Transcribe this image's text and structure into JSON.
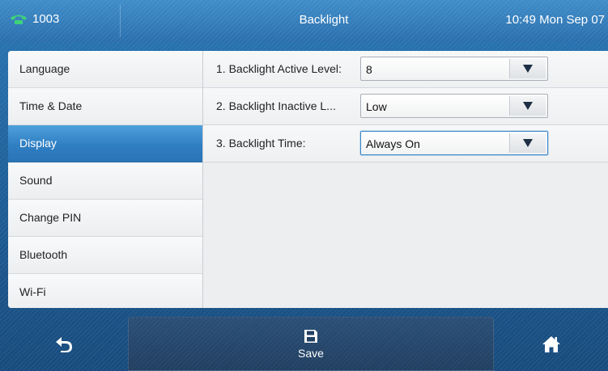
{
  "status_bar": {
    "account": "1003",
    "title": "Backlight",
    "clock": "10:49 Mon Sep 07"
  },
  "sidebar": {
    "items": [
      {
        "label": "Language",
        "active": false
      },
      {
        "label": "Time & Date",
        "active": false
      },
      {
        "label": "Display",
        "active": true
      },
      {
        "label": "Sound",
        "active": false
      },
      {
        "label": "Change PIN",
        "active": false
      },
      {
        "label": "Bluetooth",
        "active": false
      },
      {
        "label": "Wi-Fi",
        "active": false
      }
    ]
  },
  "settings": [
    {
      "label": "1. Backlight Active Level:",
      "value": "8"
    },
    {
      "label": "2. Backlight Inactive L...",
      "value": "Low"
    },
    {
      "label": "3. Backlight Time:",
      "value": "Always On",
      "focused": true
    }
  ],
  "softkeys": {
    "back_icon": "back-arrow-icon",
    "save_label": "Save",
    "save_icon": "floppy-disk-icon",
    "home_icon": "home-icon"
  },
  "colors": {
    "accent": "#2f7fc3",
    "header": "#2a6fae",
    "phone_icon": "#3fd17a"
  }
}
